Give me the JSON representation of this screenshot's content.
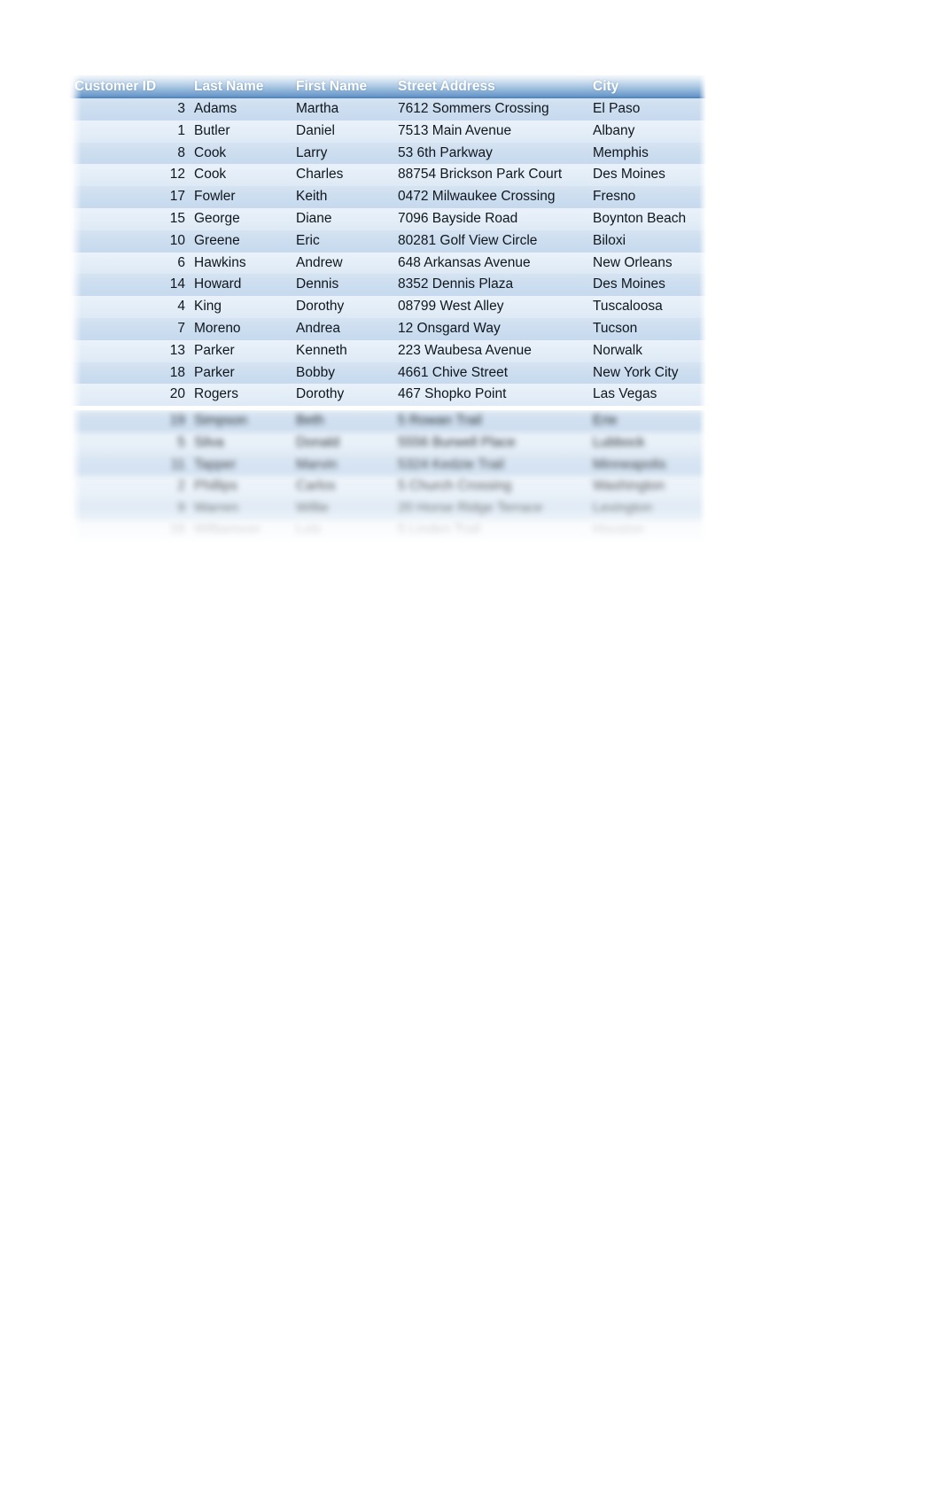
{
  "table": {
    "name": "customer-table",
    "columns": [
      {
        "key": "customer_id",
        "label": "Customer ID",
        "align": "right"
      },
      {
        "key": "last_name",
        "label": "Last Name",
        "align": "left"
      },
      {
        "key": "first_name",
        "label": "First Name",
        "align": "left"
      },
      {
        "key": "street_address",
        "label": "Street Address",
        "align": "left"
      },
      {
        "key": "city",
        "label": "City",
        "align": "left"
      }
    ],
    "header": {
      "customer_id": "Customer ID",
      "last_name": "Last Name",
      "first_name": "First Name",
      "street_address": "Street Address",
      "city": "City"
    },
    "rows": [
      {
        "customer_id": "3",
        "last_name": "Adams",
        "first_name": "Martha",
        "street_address": "7612 Sommers Crossing",
        "city": "El Paso"
      },
      {
        "customer_id": "1",
        "last_name": "Butler",
        "first_name": "Daniel",
        "street_address": "7513 Main Avenue",
        "city": "Albany"
      },
      {
        "customer_id": "8",
        "last_name": "Cook",
        "first_name": "Larry",
        "street_address": "53 6th Parkway",
        "city": "Memphis"
      },
      {
        "customer_id": "12",
        "last_name": "Cook",
        "first_name": "Charles",
        "street_address": "88754 Brickson Park Court",
        "city": "Des Moines"
      },
      {
        "customer_id": "17",
        "last_name": "Fowler",
        "first_name": "Keith",
        "street_address": "0472 Milwaukee Crossing",
        "city": "Fresno"
      },
      {
        "customer_id": "15",
        "last_name": "George",
        "first_name": "Diane",
        "street_address": "7096 Bayside Road",
        "city": "Boynton Beach"
      },
      {
        "customer_id": "10",
        "last_name": "Greene",
        "first_name": "Eric",
        "street_address": "80281 Golf View Circle",
        "city": "Biloxi"
      },
      {
        "customer_id": "6",
        "last_name": "Hawkins",
        "first_name": "Andrew",
        "street_address": "648 Arkansas Avenue",
        "city": "New Orleans"
      },
      {
        "customer_id": "14",
        "last_name": "Howard",
        "first_name": "Dennis",
        "street_address": "8352 Dennis Plaza",
        "city": "Des Moines"
      },
      {
        "customer_id": "4",
        "last_name": "King",
        "first_name": "Dorothy",
        "street_address": "08799 West Alley",
        "city": "Tuscaloosa"
      },
      {
        "customer_id": "7",
        "last_name": "Moreno",
        "first_name": "Andrea",
        "street_address": "12 Onsgard Way",
        "city": "Tucson"
      },
      {
        "customer_id": "13",
        "last_name": "Parker",
        "first_name": "Kenneth",
        "street_address": "223 Waubesa Avenue",
        "city": "Norwalk"
      },
      {
        "customer_id": "18",
        "last_name": "Parker",
        "first_name": "Bobby",
        "street_address": "4661 Chive Street",
        "city": "New York City"
      },
      {
        "customer_id": "20",
        "last_name": "Rogers",
        "first_name": "Dorothy",
        "street_address": "467 Shopko Point",
        "city": "Las Vegas"
      }
    ],
    "faded_rows": [
      {
        "customer_id": "19",
        "last_name": "Simpson",
        "first_name": "Beth",
        "street_address": "5 Rowan Trail",
        "city": "Erie"
      },
      {
        "customer_id": "5",
        "last_name": "Silva",
        "first_name": "Donald",
        "street_address": "5556 Burwell Place",
        "city": "Lubbock"
      },
      {
        "customer_id": "11",
        "last_name": "Tapper",
        "first_name": "Marvin",
        "street_address": "5324 Kedzie Trail",
        "city": "Minneapolis"
      },
      {
        "customer_id": "2",
        "last_name": "Phillips",
        "first_name": "Carlos",
        "street_address": "5 Church Crossing",
        "city": "Washington"
      },
      {
        "customer_id": "9",
        "last_name": "Warren",
        "first_name": "Willie",
        "street_address": "20 Horse Ridge Terrace",
        "city": "Lexington"
      },
      {
        "customer_id": "16",
        "last_name": "Williamson",
        "first_name": "Lois",
        "street_address": "5 Linden Trail",
        "city": "Houston"
      }
    ]
  },
  "style": {
    "header_text_color": "#ffffff",
    "header_gradient_top": "#f4f8fc",
    "header_gradient_bottom": "#4a7fba",
    "band_a": "#cddef0",
    "band_b": "#e4eef8",
    "body_text_color": "#10161c",
    "page_background": "#ffffff"
  }
}
